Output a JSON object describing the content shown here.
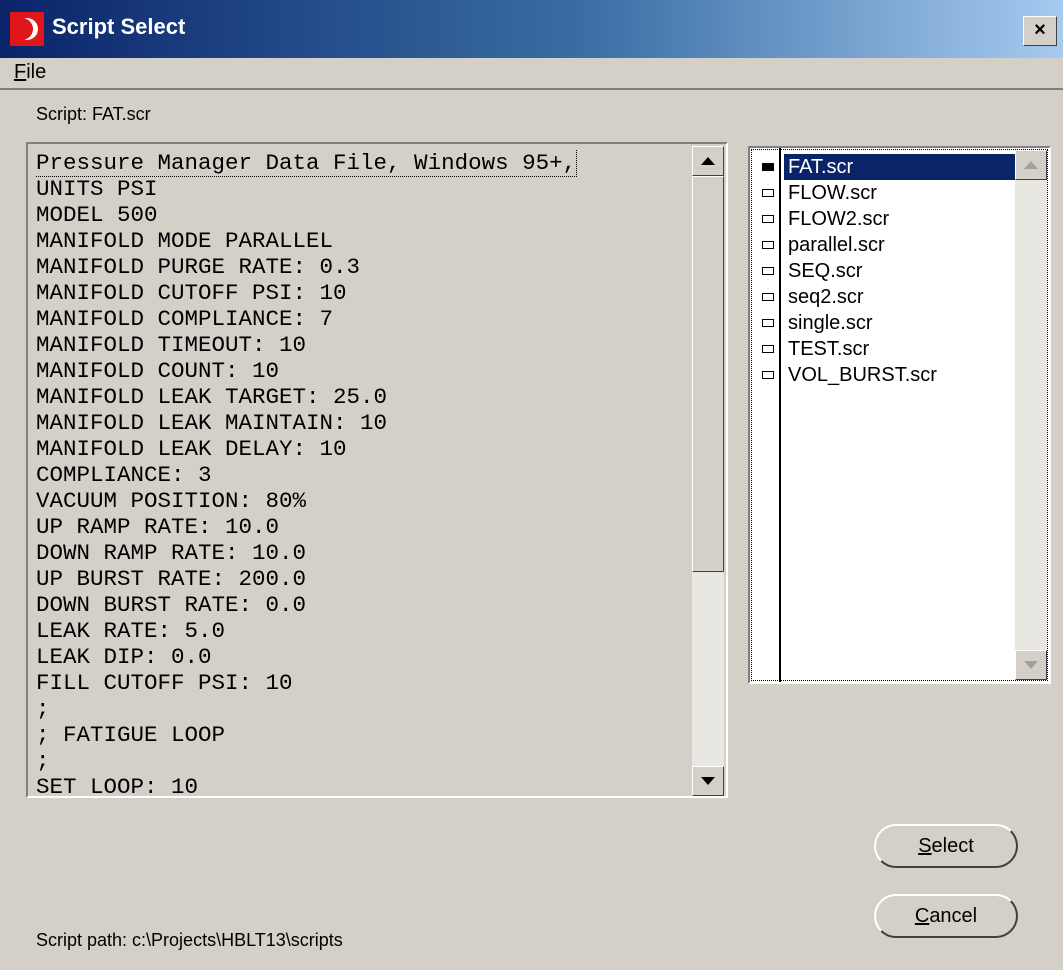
{
  "window": {
    "title": "Script Select",
    "close_label": "×"
  },
  "menu": {
    "file_label": "File",
    "file_mnemonic": "F",
    "file_rest": "ile"
  },
  "script_label": "Script: FAT.scr",
  "script_text_lines": [
    "Pressure Manager Data File, Windows 95+,",
    "UNITS PSI",
    "MODEL 500",
    "MANIFOLD MODE PARALLEL",
    "MANIFOLD PURGE RATE: 0.3",
    "MANIFOLD CUTOFF PSI: 10",
    "MANIFOLD COMPLIANCE: 7",
    "MANIFOLD TIMEOUT: 10",
    "MANIFOLD COUNT: 10",
    "MANIFOLD LEAK TARGET: 25.0",
    "MANIFOLD LEAK MAINTAIN: 10",
    "MANIFOLD LEAK DELAY: 10",
    "COMPLIANCE: 3",
    "VACUUM POSITION: 80%",
    "UP RAMP RATE: 10.0",
    "DOWN RAMP RATE: 10.0",
    "UP BURST RATE: 200.0",
    "DOWN BURST RATE: 0.0",
    "LEAK RATE: 5.0",
    "LEAK DIP: 0.0",
    "FILL CUTOFF PSI: 10",
    ";",
    "; FATIGUE LOOP",
    ";",
    "SET LOOP: 10"
  ],
  "script_files": [
    {
      "name": "FAT.scr",
      "selected": true
    },
    {
      "name": "FLOW.scr",
      "selected": false
    },
    {
      "name": "FLOW2.scr",
      "selected": false
    },
    {
      "name": "parallel.scr",
      "selected": false
    },
    {
      "name": "SEQ.scr",
      "selected": false
    },
    {
      "name": "seq2.scr",
      "selected": false
    },
    {
      "name": "single.scr",
      "selected": false
    },
    {
      "name": "TEST.scr",
      "selected": false
    },
    {
      "name": "VOL_BURST.scr",
      "selected": false
    }
  ],
  "buttons": {
    "select": {
      "label": "Select",
      "mnemonic": "S",
      "rest": "elect"
    },
    "cancel": {
      "label": "Cancel",
      "mnemonic": "C",
      "rest": "ancel"
    }
  },
  "script_path_label": "Script path: c:\\Projects\\HBLT13\\scripts",
  "icons": {
    "app": "app-moon-icon",
    "close": "close-icon",
    "scroll_up": "arrow-up-icon",
    "scroll_down": "arrow-down-icon"
  }
}
